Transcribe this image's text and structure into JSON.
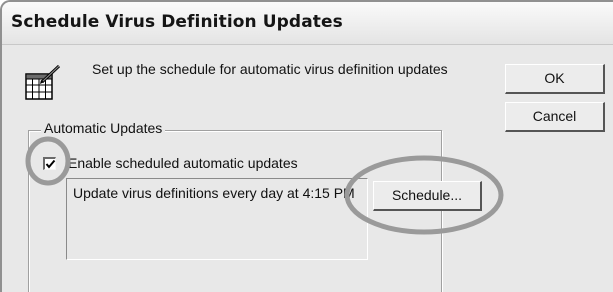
{
  "dialog": {
    "title": "Schedule Virus Definition Updates",
    "intro_text": "Set up the schedule for automatic virus definition updates",
    "icon": "calendar-pen-icon"
  },
  "buttons": {
    "ok_label": "OK",
    "cancel_label": "Cancel",
    "schedule_label": "Schedule..."
  },
  "automatic_updates": {
    "group_label": "Automatic Updates",
    "enable_checkbox_label": "Enable scheduled automatic updates",
    "enable_checked": true,
    "schedule_summary": "Update virus definitions every day at 4:15 PM"
  },
  "annotation": {
    "highlight_color": "#9a9a9a"
  }
}
